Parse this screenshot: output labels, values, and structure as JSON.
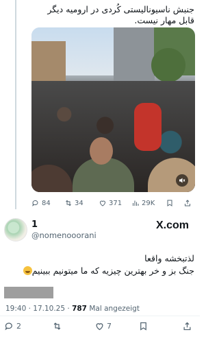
{
  "parent_tweet": {
    "text": "جنبش ناسیونالیستی کُردی در ارومیه دیگر قابل مهار نیست.",
    "video": {
      "description_icon": "mute-icon"
    },
    "stats": {
      "replies": "84",
      "reposts": "34",
      "likes": "371",
      "views": "29K"
    }
  },
  "tweet": {
    "display_name": "1",
    "handle": "@nomenooorani",
    "brand": "X.com",
    "text_line1": "لذتبخشه واقعا",
    "text_line2": "جنگ بز و خر بهترین چیزیه که ما میتونیم ببینیم",
    "emoji": "rolling-on-floor-laughing",
    "time": "19:40 · 17.10.25 ·",
    "views_count": "787",
    "views_label": "Mal angezeigt",
    "stats": {
      "replies": "2",
      "reposts": "",
      "likes": "7"
    }
  }
}
